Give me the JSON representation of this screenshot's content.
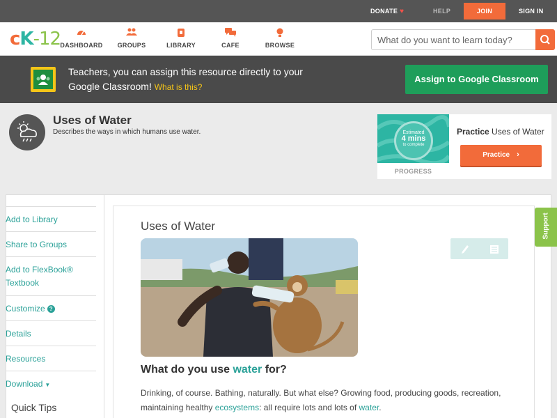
{
  "topbar": {
    "donate": "DONATE",
    "help": "HELP",
    "join": "JOIN",
    "signin": "SIGN IN"
  },
  "nav": {
    "logo_c": "c",
    "logo_k": "K",
    "logo_12": "-12",
    "items": [
      {
        "label": "DASHBOARD",
        "icon": "dashboard-icon"
      },
      {
        "label": "GROUPS",
        "icon": "groups-icon"
      },
      {
        "label": "LIBRARY",
        "icon": "library-icon"
      },
      {
        "label": "CAFE",
        "icon": "cafe-icon"
      },
      {
        "label": "BROWSE",
        "icon": "browse-icon"
      }
    ],
    "search_placeholder": "What do you want to learn today?"
  },
  "banner": {
    "text": "Teachers, you can assign this resource directly to your Google Classroom!",
    "what_link": "What is this?",
    "assign_button": "Assign to Google Classroom"
  },
  "concept": {
    "title": "Uses of Water",
    "description": "Describes the ways in which humans use water."
  },
  "practice": {
    "estimated": "Estimated",
    "minutes": "4 mins",
    "to_complete": "to complete",
    "progress_label": "PROGRESS",
    "title_bold": "Practice",
    "title_rest": "Uses of Water",
    "button": "Practice"
  },
  "sidebar": {
    "items": [
      {
        "label": "Add to Library"
      },
      {
        "label": "Share to Groups"
      },
      {
        "label": "Add to FlexBook® Textbook"
      },
      {
        "label": "Customize"
      },
      {
        "label": "Details"
      },
      {
        "label": "Resources"
      },
      {
        "label": "Download"
      }
    ],
    "quick_tips": "Quick Tips"
  },
  "content": {
    "title": "Uses of Water",
    "question_pre": "What do you use ",
    "question_hl": "water",
    "question_post": " for?",
    "body_1": "Drinking, of course. Bathing, naturally. But what else? Growing food, producing goods, recreation, maintaining healthy ",
    "body_link1": "ecosystems",
    "body_2": ": all require lots and lots of ",
    "body_link2": "water",
    "body_3": "."
  },
  "support": "Support",
  "colors": {
    "accent_orange": "#f26b3a",
    "accent_teal": "#2aa198",
    "google_green": "#1e9e5a",
    "support_green": "#8bc34a"
  }
}
